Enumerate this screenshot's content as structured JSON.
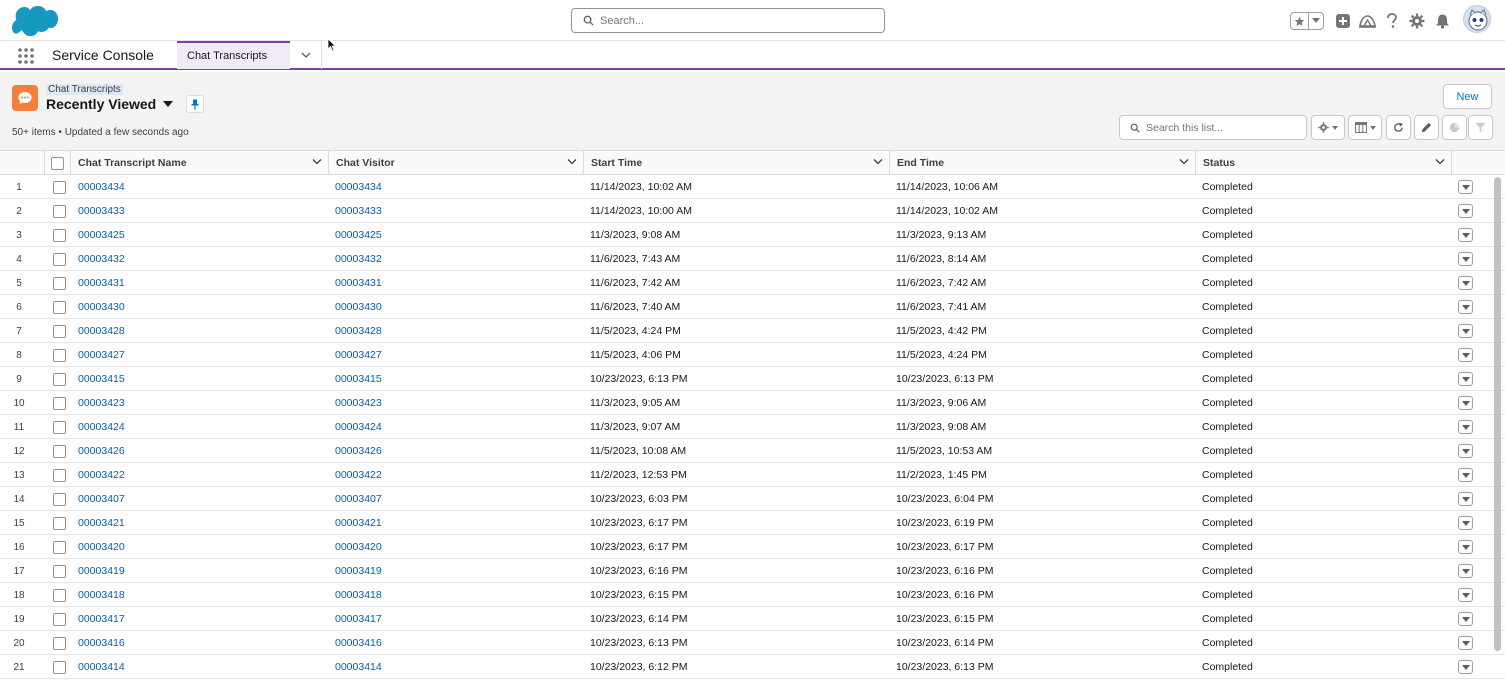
{
  "header": {
    "search_placeholder": "Search..."
  },
  "nav": {
    "app_name": "Service Console",
    "tab_label": "Chat Transcripts"
  },
  "list": {
    "object_label": "Chat Transcripts",
    "view_name": "Recently Viewed",
    "meta": "50+ items • Updated a few seconds ago",
    "new_button": "New",
    "search_placeholder": "Search this list..."
  },
  "columns": [
    "Chat Transcript Name",
    "Chat Visitor",
    "Start Time",
    "End Time",
    "Status"
  ],
  "rows": [
    {
      "n": "1",
      "name": "00003434",
      "visitor": "00003434",
      "start": "11/14/2023, 10:02 AM",
      "end": "11/14/2023, 10:06 AM",
      "status": "Completed"
    },
    {
      "n": "2",
      "name": "00003433",
      "visitor": "00003433",
      "start": "11/14/2023, 10:00 AM",
      "end": "11/14/2023, 10:02 AM",
      "status": "Completed"
    },
    {
      "n": "3",
      "name": "00003425",
      "visitor": "00003425",
      "start": "11/3/2023, 9:08 AM",
      "end": "11/3/2023, 9:13 AM",
      "status": "Completed"
    },
    {
      "n": "4",
      "name": "00003432",
      "visitor": "00003432",
      "start": "11/6/2023, 7:43 AM",
      "end": "11/6/2023, 8:14 AM",
      "status": "Completed"
    },
    {
      "n": "5",
      "name": "00003431",
      "visitor": "00003431",
      "start": "11/6/2023, 7:42 AM",
      "end": "11/6/2023, 7:42 AM",
      "status": "Completed"
    },
    {
      "n": "6",
      "name": "00003430",
      "visitor": "00003430",
      "start": "11/6/2023, 7:40 AM",
      "end": "11/6/2023, 7:41 AM",
      "status": "Completed"
    },
    {
      "n": "7",
      "name": "00003428",
      "visitor": "00003428",
      "start": "11/5/2023, 4:24 PM",
      "end": "11/5/2023, 4:42 PM",
      "status": "Completed"
    },
    {
      "n": "8",
      "name": "00003427",
      "visitor": "00003427",
      "start": "11/5/2023, 4:06 PM",
      "end": "11/5/2023, 4:24 PM",
      "status": "Completed"
    },
    {
      "n": "9",
      "name": "00003415",
      "visitor": "00003415",
      "start": "10/23/2023, 6:13 PM",
      "end": "10/23/2023, 6:13 PM",
      "status": "Completed"
    },
    {
      "n": "10",
      "name": "00003423",
      "visitor": "00003423",
      "start": "11/3/2023, 9:05 AM",
      "end": "11/3/2023, 9:06 AM",
      "status": "Completed"
    },
    {
      "n": "11",
      "name": "00003424",
      "visitor": "00003424",
      "start": "11/3/2023, 9:07 AM",
      "end": "11/3/2023, 9:08 AM",
      "status": "Completed"
    },
    {
      "n": "12",
      "name": "00003426",
      "visitor": "00003426",
      "start": "11/5/2023, 10:08 AM",
      "end": "11/5/2023, 10:53 AM",
      "status": "Completed"
    },
    {
      "n": "13",
      "name": "00003422",
      "visitor": "00003422",
      "start": "11/2/2023, 12:53 PM",
      "end": "11/2/2023, 1:45 PM",
      "status": "Completed"
    },
    {
      "n": "14",
      "name": "00003407",
      "visitor": "00003407",
      "start": "10/23/2023, 6:03 PM",
      "end": "10/23/2023, 6:04 PM",
      "status": "Completed"
    },
    {
      "n": "15",
      "name": "00003421",
      "visitor": "00003421",
      "start": "10/23/2023, 6:17 PM",
      "end": "10/23/2023, 6:19 PM",
      "status": "Completed"
    },
    {
      "n": "16",
      "name": "00003420",
      "visitor": "00003420",
      "start": "10/23/2023, 6:17 PM",
      "end": "10/23/2023, 6:17 PM",
      "status": "Completed"
    },
    {
      "n": "17",
      "name": "00003419",
      "visitor": "00003419",
      "start": "10/23/2023, 6:16 PM",
      "end": "10/23/2023, 6:16 PM",
      "status": "Completed"
    },
    {
      "n": "18",
      "name": "00003418",
      "visitor": "00003418",
      "start": "10/23/2023, 6:15 PM",
      "end": "10/23/2023, 6:16 PM",
      "status": "Completed"
    },
    {
      "n": "19",
      "name": "00003417",
      "visitor": "00003417",
      "start": "10/23/2023, 6:14 PM",
      "end": "10/23/2023, 6:15 PM",
      "status": "Completed"
    },
    {
      "n": "20",
      "name": "00003416",
      "visitor": "00003416",
      "start": "10/23/2023, 6:13 PM",
      "end": "10/23/2023, 6:14 PM",
      "status": "Completed"
    },
    {
      "n": "21",
      "name": "00003414",
      "visitor": "00003414",
      "start": "10/23/2023, 6:12 PM",
      "end": "10/23/2023, 6:13 PM",
      "status": "Completed"
    }
  ],
  "colors": {
    "brand_blue": "#0176d3",
    "link_blue": "#0b5cab",
    "console_purple": "#7f3fb2",
    "object_icon_orange": "#f4813a"
  },
  "icons": {
    "logo": "salesforce-cloud-logo",
    "search": "search-icon",
    "favorites": "star-icon",
    "add": "add-icon",
    "trailhead": "trailhead-icon",
    "help": "help-icon",
    "setup": "gear-icon",
    "notifications": "bell-icon",
    "avatar": "astro-avatar",
    "app_launcher": "waffle-icon",
    "object": "chat-icon"
  }
}
